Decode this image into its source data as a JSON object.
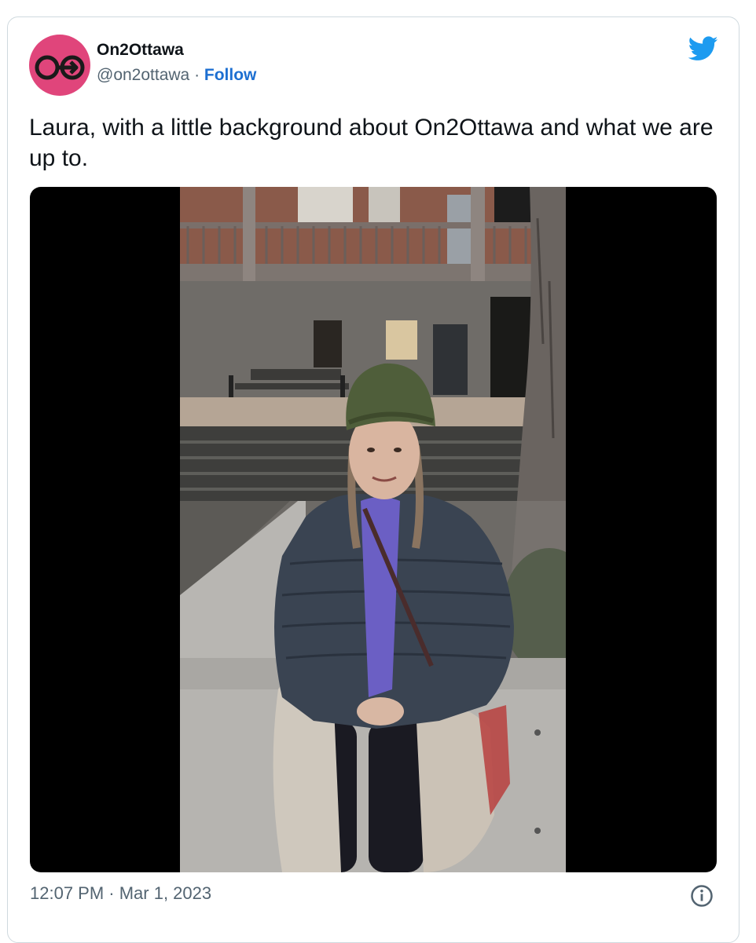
{
  "author": {
    "name": "On2Ottawa",
    "handle": "@on2ottawa",
    "separator": " · ",
    "follow_label": "Follow",
    "avatar_color": "#e0457b"
  },
  "tweet": {
    "text": "Laura, with a little background about On2Ottawa and what we are up to.",
    "timestamp": "12:07 PM · Mar 1, 2023"
  },
  "media": {
    "type": "video",
    "subject": "woman in green knit beanie and dark puffer jacket sitting on concrete planter ledge in front of stone building with balcony"
  },
  "icons": {
    "platform": "twitter-bird-icon",
    "info": "info-icon"
  },
  "colors": {
    "brand_blue": "#1d9bf0",
    "link_blue": "#1d6fd1",
    "muted": "#536471"
  }
}
